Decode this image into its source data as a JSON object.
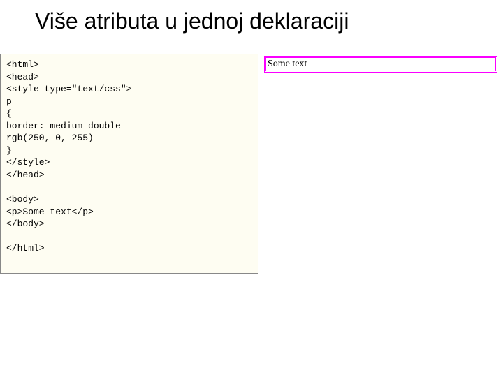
{
  "title": "Više atributa u jednoj deklaraciji",
  "code": {
    "l1": "<html>",
    "l2": "<head>",
    "l3": "<style type=\"text/css\">",
    "l4": "p",
    "l5": "{",
    "l6": "border: medium double",
    "l7": "rgb(250, 0, 255)",
    "l8": "}",
    "l9": "</style>",
    "l10": "</head>",
    "blank1": "",
    "l11": "<body>",
    "l12": "<p>Some text</p>",
    "l13": "</body>",
    "blank2": "",
    "l14": "</html>"
  },
  "preview": {
    "paragraph_text": "Some text"
  }
}
